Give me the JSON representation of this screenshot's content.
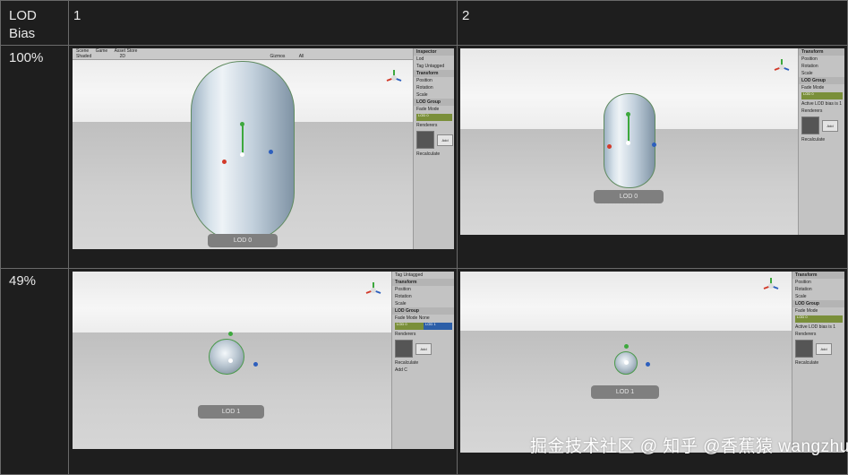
{
  "table": {
    "header_lod_bias": "LOD\nBias",
    "header_col1": "1",
    "header_col2": "2",
    "rows": [
      {
        "bias": "100%"
      },
      {
        "bias": "49%"
      }
    ]
  },
  "scene_tabs": {
    "scene": "Scene",
    "game": "Game",
    "asset_store": "Asset Store",
    "shading": "Shaded",
    "mode_2d": "2D",
    "gizmos": "Gizmos",
    "search": "All"
  },
  "inspector": {
    "title": "Inspector",
    "object_name": "Lod",
    "tag_label": "Tag",
    "tag_value": "Untagged",
    "transform": "Transform",
    "position": "Position",
    "rotation": "Rotation",
    "scale": "Scale",
    "lod_group": "LOD Group",
    "fade_mode": "Fade Mode",
    "fade_value": "None",
    "lod0_bar": "LOD 0",
    "lod0_pct": "100%",
    "lod1_bar": "LOD 1",
    "renderers": "Renderers",
    "add": "Add",
    "recalculate": "Recalculate",
    "active_lod": "Active LOD bias is 1",
    "add_component": "Add C"
  },
  "lod_labels": {
    "r1c1": "LOD 0",
    "r1c2": "LOD 0",
    "r2c1": "LOD 1",
    "r2c2": "LOD 1"
  },
  "watermark": "掘金技术社区 @ 知乎 @香蕉猿 wangzhuanx",
  "colors": {
    "lod0_bar": "#7a8f3a",
    "lod1_bar": "#2d5fa8",
    "grid_line": "#6a6a6a"
  }
}
